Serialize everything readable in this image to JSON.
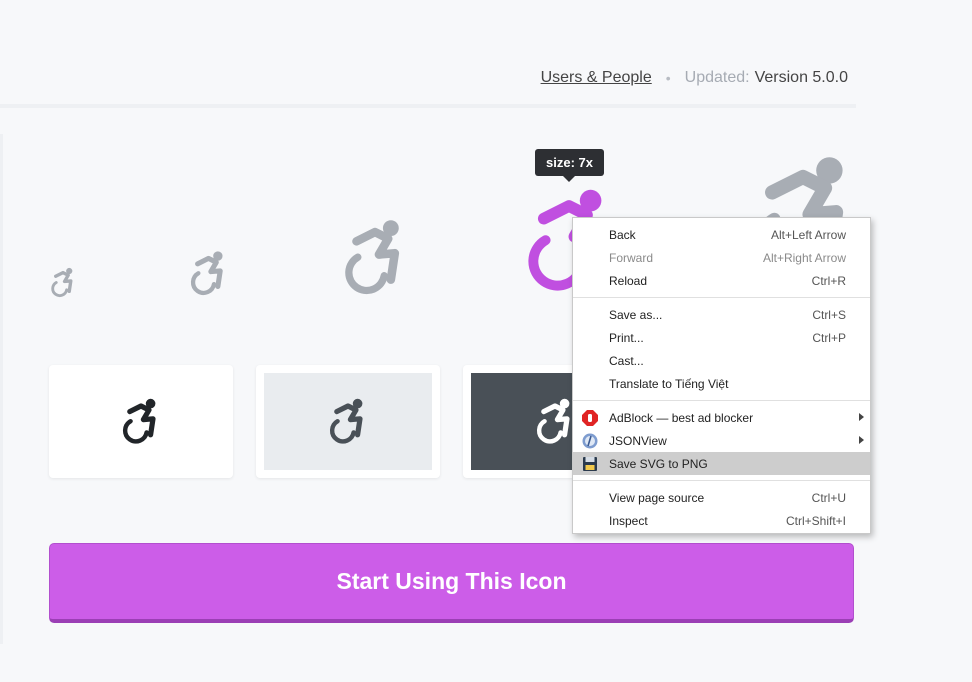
{
  "meta": {
    "category_link": "Users & People",
    "separator": "•",
    "updated_label": "Updated:",
    "updated_value": "Version 5.0.0"
  },
  "icon": {
    "name": "accessible-icon",
    "default_color": "#a8adb4",
    "active_color": "#c04fe0"
  },
  "tooltip": {
    "text": "size: 7x"
  },
  "cards": [
    {
      "background": "white",
      "icon_color": "#212529"
    },
    {
      "background": "light",
      "icon_color": "#495057"
    },
    {
      "background": "dark",
      "icon_color": "#ffffff"
    }
  ],
  "cta": {
    "label": "Start Using This Icon",
    "color": "#cc5de8"
  },
  "context_menu": {
    "items": [
      {
        "label": "Back",
        "shortcut": "Alt+Left Arrow"
      },
      {
        "label": "Forward",
        "shortcut": "Alt+Right Arrow",
        "disabled": true
      },
      {
        "label": "Reload",
        "shortcut": "Ctrl+R"
      },
      {
        "label": "Save as...",
        "shortcut": "Ctrl+S"
      },
      {
        "label": "Print...",
        "shortcut": "Ctrl+P"
      },
      {
        "label": "Cast..."
      },
      {
        "label": "Translate to Tiếng Việt"
      },
      {
        "label": "AdBlock — best ad blocker",
        "icon": "adblock-icon",
        "submenu": true
      },
      {
        "label": "JSONView",
        "icon": "jsonview-icon",
        "submenu": true
      },
      {
        "label": "Save SVG to PNG",
        "icon": "floppy-disk-icon",
        "highlighted": true
      },
      {
        "label": "View page source",
        "shortcut": "Ctrl+U"
      },
      {
        "label": "Inspect",
        "shortcut": "Ctrl+Shift+I"
      }
    ]
  }
}
